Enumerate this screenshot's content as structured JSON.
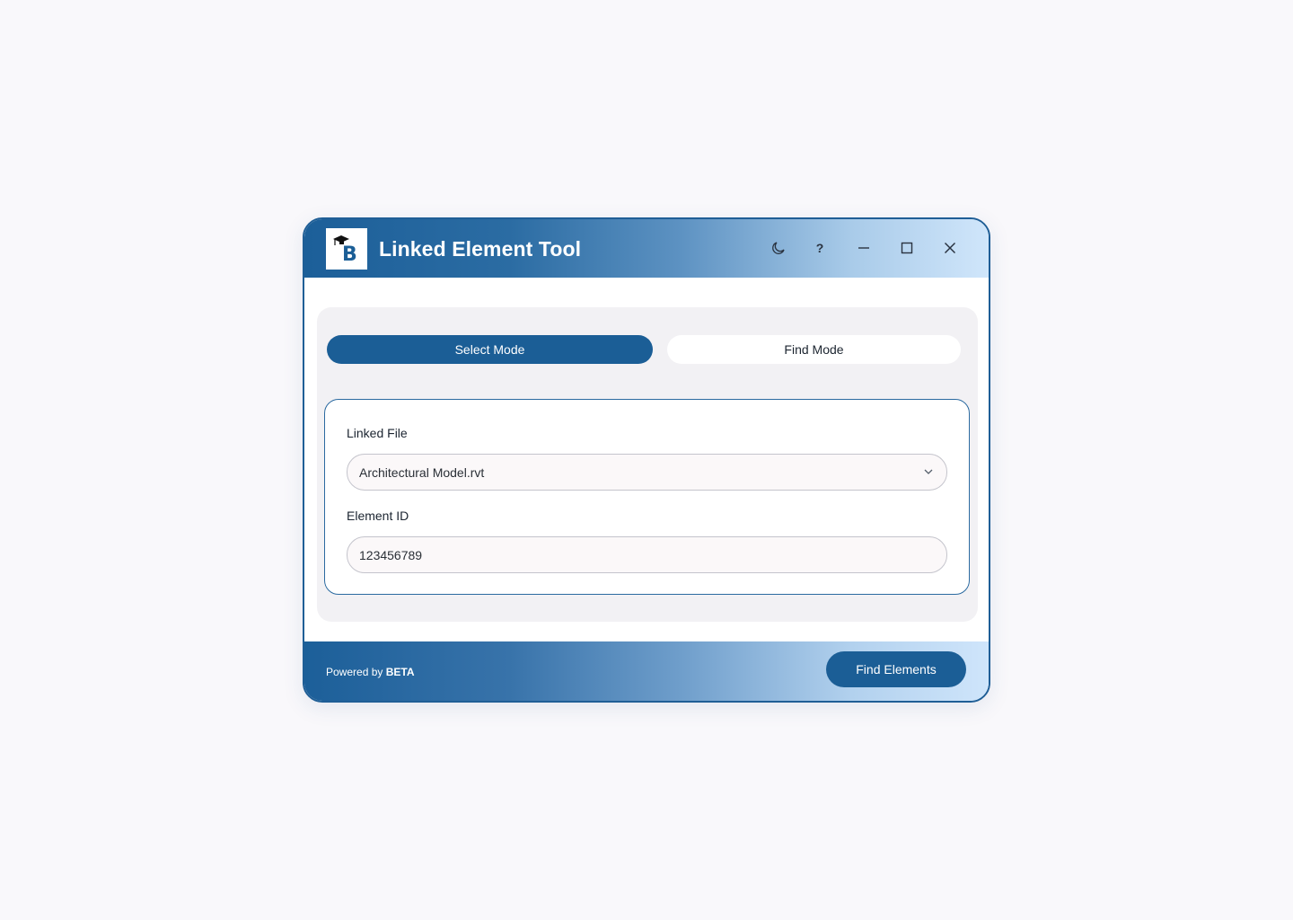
{
  "window": {
    "title": "Linked Element Tool",
    "logo_letter": "B",
    "controls": {
      "theme": "moon-icon",
      "help": "?",
      "minimize": "minimize-icon",
      "maximize": "maximize-icon",
      "close": "close-icon"
    }
  },
  "modes": {
    "select_label": "Select Mode",
    "find_label": "Find Mode",
    "active": "Select Mode"
  },
  "form": {
    "linked_file_label": "Linked File",
    "linked_file_value": "Architectural Model.rvt",
    "element_id_label": "Element ID",
    "element_id_value": "123456789"
  },
  "footer": {
    "powered_prefix": "Powered by",
    "powered_brand": "BETA",
    "find_button_label": "Find Elements"
  },
  "colors": {
    "accent": "#1b5e96",
    "page_background": "#f9f8fb",
    "panel_background": "#f2f1f4"
  }
}
